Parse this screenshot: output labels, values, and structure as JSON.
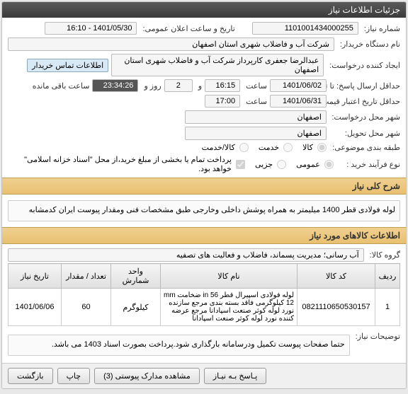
{
  "mainHeader": "جزئیات اطلاعات نیاز",
  "fields": {
    "needNo_lbl": "شماره نیاز:",
    "needNo": "1101001434000255",
    "annDate_lbl": "تاریخ و ساعت اعلان عمومی:",
    "annDate": "1401/05/30 - 16:10",
    "buyer_lbl": "نام دستگاه خریدار:",
    "buyer": "شرکت آب و فاضلاب شهری استان اصفهان",
    "requester_lbl": "ایجاد کننده درخواست:",
    "requester": "عبدالرضا جعفری کارپرداز شرکت آب و فاضلاب شهری استان اصفهان",
    "contactInfo": "اطلاعات تماس خریدار",
    "deadline_lbl": "حداقل ارسال پاسخ: تا تاریخ:",
    "deadline_date": "1401/06/02",
    "deadline_time_lbl": "ساعت",
    "deadline_time": "16:15",
    "deadline_days_lbl": "و",
    "deadline_days": "2",
    "deadline_rem_lbl": "روز و",
    "deadline_rem": "23:34:26",
    "deadline_rem_suffix": "ساعت باقی مانده",
    "validity_lbl": "حداقل تاریخ اعتبار قیمت: تا تاریخ:",
    "validity_date": "1401/06/31",
    "validity_time_lbl": "ساعت",
    "validity_time": "17:00",
    "reqCity_lbl": "شهر محل درخواست:",
    "reqCity": "اصفهان",
    "delivCity_lbl": "شهر محل تحویل:",
    "delivCity": "اصفهان",
    "category_lbl": "طبقه بندی موضوعی:",
    "category_a": "کالا",
    "category_b": "خدمت",
    "category_c": "کالا/خدمت",
    "process_lbl": "نوع فرآیند خرید :",
    "process_a": "عمومی",
    "process_b": "جزیی",
    "process_note": "پرداخت تمام یا بخشی از مبلغ خرید،از محل \"اسناد خزانه اسلامی\" خواهد بود.",
    "titleHeader": "شرح کلی نیاز",
    "title": "لوله فولادی قطر 1400 میلیمتر به همراه پوشش داخلی وخارجی طبق مشخصات فنی ومقدار پیوست ایران کدمشابه",
    "itemsHeader": "اطلاعات کالاهای مورد نیاز",
    "group_lbl": "گروه کالا:",
    "group": "آب رسانی؛ مدیریت پسماند، فاضلاب و فعالیت های تصفیه",
    "notes_lbl": "توضیحات نیاز:",
    "notes": "حتما صفحات پیوست تکمیل ودرسامانه بارگذاری شود.پرداخت بصورت اسناد 1403 می باشد."
  },
  "table": {
    "headers": [
      "ردیف",
      "کد کالا",
      "نام کالا",
      "واحد شمارش",
      "تعداد / مقدار",
      "تاریخ نیاز"
    ],
    "rows": [
      {
        "idx": "1",
        "code": "0821110650530157",
        "name": "لوله فولادی اسپیرال قطر in 56 ضخامت mm 12 کیلوگرمی فاقد بسته بندی مرجع سازنده نورد لوله کوثر صنعت اسپادانا مرجع عرضه کننده نورد لوله کوثر صنعت اسپادانا",
        "unit": "کیلوگرم",
        "qty": "60",
        "date": "1401/06/06"
      }
    ]
  },
  "buttons": {
    "close": "بازگشت",
    "print": "چاپ",
    "attach": "مشاهده مدارک پیوستی (3)",
    "respond": "پـاسخ بـه نیـاز"
  }
}
